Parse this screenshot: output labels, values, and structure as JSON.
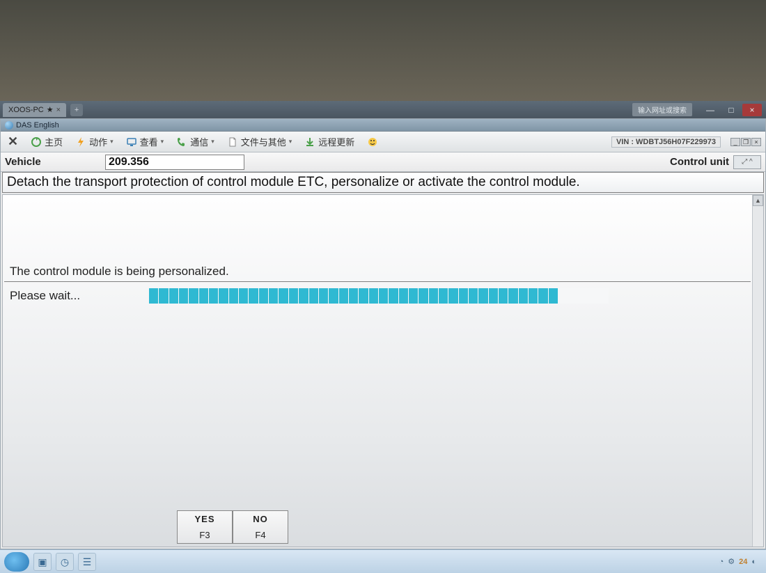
{
  "browser": {
    "tab_label": "XOOS-PC",
    "address_hint": "输入网址或搜索",
    "win_min": "—",
    "win_max": "□",
    "win_close": "×"
  },
  "app": {
    "title": "DAS English",
    "toolbar": {
      "close_label": "",
      "home": "主页",
      "action": "动作",
      "view": "查看",
      "comm": "通信",
      "files": "文件与其他",
      "remote": "远程更新"
    },
    "vin_label": "VIN : WDBTJ56H07F229973",
    "vehicle_label": "Vehicle",
    "vehicle_value": "209.356",
    "control_unit_label": "Control unit",
    "cu_box": "⤢ ^",
    "instruction": "Detach the transport protection of control module ETC, personalize or activate the control module.",
    "status": "The control module is being personalized.",
    "wait": "Please wait...",
    "progress_filled": 41,
    "progress_total": 46,
    "fkeys": {
      "yes": "YES",
      "yes_key": "F3",
      "no": "NO",
      "no_key": "F4"
    }
  },
  "taskbar": {
    "tray_num": "24"
  },
  "icons": {
    "close_x": "✕",
    "home": "home-icon",
    "bolt": "bolt-icon",
    "monitor": "monitor-icon",
    "phone": "phone-icon",
    "file": "file-icon",
    "download": "download-icon",
    "smile": "smile-icon",
    "star": "★",
    "plus": "+",
    "refresh": "⟳",
    "scroll_up": "▲",
    "scroll_dn": "▼"
  }
}
